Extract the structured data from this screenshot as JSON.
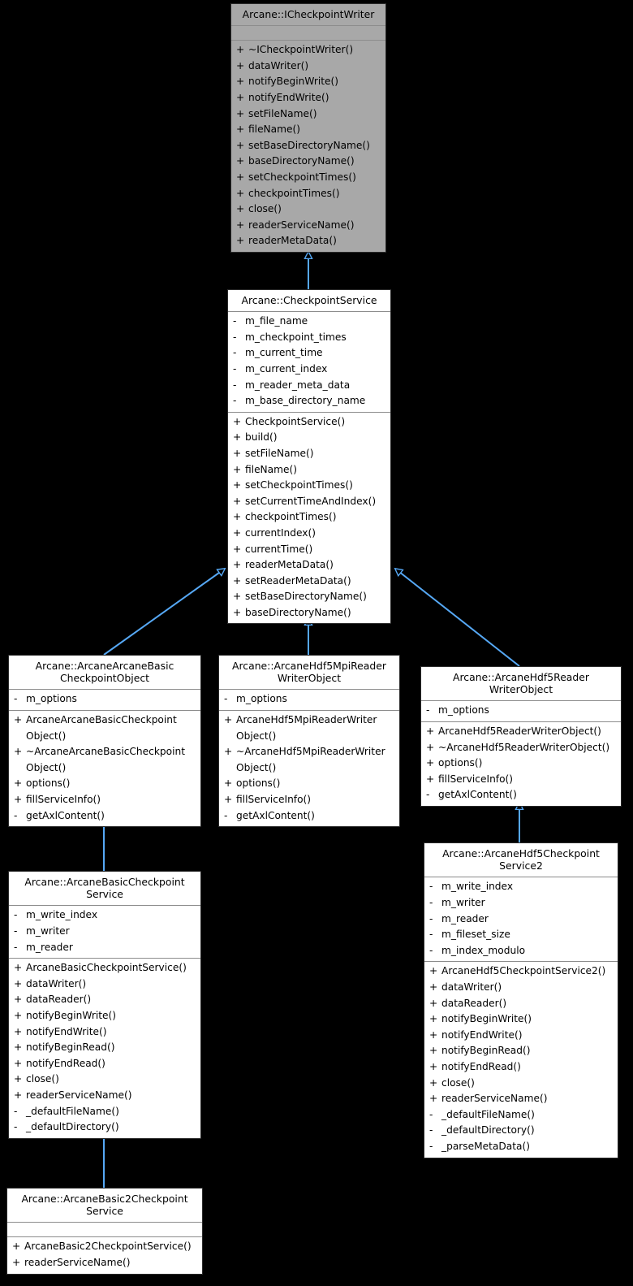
{
  "diagram": {
    "type": "uml-class-inheritance",
    "background": "#000000",
    "edge_color": "#56a8f5",
    "interface_fill": "#a8a8a8",
    "class_fill": "#ffffff"
  },
  "classes": [
    {
      "id": "icheckpointwriter",
      "title": "Arcane::ICheckpointWriter",
      "title_lines": [
        "Arcane::ICheckpointWriter"
      ],
      "attributes": [],
      "methods": [
        {
          "vis": "+",
          "name": "~ICheckpointWriter()"
        },
        {
          "vis": "+",
          "name": "dataWriter()"
        },
        {
          "vis": "+",
          "name": "notifyBeginWrite()"
        },
        {
          "vis": "+",
          "name": "notifyEndWrite()"
        },
        {
          "vis": "+",
          "name": "setFileName()"
        },
        {
          "vis": "+",
          "name": "fileName()"
        },
        {
          "vis": "+",
          "name": "setBaseDirectoryName()"
        },
        {
          "vis": "+",
          "name": "baseDirectoryName()"
        },
        {
          "vis": "+",
          "name": "setCheckpointTimes()"
        },
        {
          "vis": "+",
          "name": "checkpointTimes()"
        },
        {
          "vis": "+",
          "name": "close()"
        },
        {
          "vis": "+",
          "name": "readerServiceName()"
        },
        {
          "vis": "+",
          "name": "readerMetaData()"
        }
      ]
    },
    {
      "id": "checkpointservice",
      "title": "Arcane::CheckpointService",
      "title_lines": [
        "Arcane::CheckpointService"
      ],
      "attributes": [
        {
          "vis": "-",
          "name": "m_file_name"
        },
        {
          "vis": "-",
          "name": "m_checkpoint_times"
        },
        {
          "vis": "-",
          "name": "m_current_time"
        },
        {
          "vis": "-",
          "name": "m_current_index"
        },
        {
          "vis": "-",
          "name": "m_reader_meta_data"
        },
        {
          "vis": "-",
          "name": "m_base_directory_name"
        }
      ],
      "methods": [
        {
          "vis": "+",
          "name": "CheckpointService()"
        },
        {
          "vis": "+",
          "name": "build()"
        },
        {
          "vis": "+",
          "name": "setFileName()"
        },
        {
          "vis": "+",
          "name": "fileName()"
        },
        {
          "vis": "+",
          "name": "setCheckpointTimes()"
        },
        {
          "vis": "+",
          "name": "setCurrentTimeAndIndex()"
        },
        {
          "vis": "+",
          "name": "checkpointTimes()"
        },
        {
          "vis": "+",
          "name": "currentIndex()"
        },
        {
          "vis": "+",
          "name": "currentTime()"
        },
        {
          "vis": "+",
          "name": "readerMetaData()"
        },
        {
          "vis": "+",
          "name": "setReaderMetaData()"
        },
        {
          "vis": "+",
          "name": "setBaseDirectoryName()"
        },
        {
          "vis": "+",
          "name": "baseDirectoryName()"
        }
      ]
    },
    {
      "id": "arcanearcanebasiccheckpointobject",
      "title": "Arcane::ArcaneArcaneBasic CheckpointObject",
      "title_lines": [
        "Arcane::ArcaneArcaneBasic",
        "CheckpointObject"
      ],
      "attributes": [
        {
          "vis": "-",
          "name": "m_options"
        }
      ],
      "methods": [
        {
          "vis": "+",
          "name": "ArcaneArcaneBasicCheckpoint Object()",
          "wrapped": [
            "ArcaneArcaneBasicCheckpoint",
            "Object()"
          ]
        },
        {
          "vis": "+",
          "name": "~ArcaneArcaneBasicCheckpoint Object()",
          "wrapped": [
            "~ArcaneArcaneBasicCheckpoint",
            "Object()"
          ]
        },
        {
          "vis": "+",
          "name": "options()"
        },
        {
          "vis": "+",
          "name": "fillServiceInfo()"
        },
        {
          "vis": "-",
          "name": "getAxlContent()"
        }
      ]
    },
    {
      "id": "arcanehdf5mpireaderwriterobject",
      "title": "Arcane::ArcaneHdf5MpiReader WriterObject",
      "title_lines": [
        "Arcane::ArcaneHdf5MpiReader",
        "WriterObject"
      ],
      "attributes": [
        {
          "vis": "-",
          "name": "m_options"
        }
      ],
      "methods": [
        {
          "vis": "+",
          "name": "ArcaneHdf5MpiReaderWriter Object()",
          "wrapped": [
            "ArcaneHdf5MpiReaderWriter",
            "Object()"
          ]
        },
        {
          "vis": "+",
          "name": "~ArcaneHdf5MpiReaderWriter Object()",
          "wrapped": [
            "~ArcaneHdf5MpiReaderWriter",
            "Object()"
          ]
        },
        {
          "vis": "+",
          "name": "options()"
        },
        {
          "vis": "+",
          "name": "fillServiceInfo()"
        },
        {
          "vis": "-",
          "name": "getAxlContent()"
        }
      ]
    },
    {
      "id": "arcanehdf5readerwriterobject",
      "title": "Arcane::ArcaneHdf5Reader WriterObject",
      "title_lines": [
        "Arcane::ArcaneHdf5Reader",
        "WriterObject"
      ],
      "attributes": [
        {
          "vis": "-",
          "name": "m_options"
        }
      ],
      "methods": [
        {
          "vis": "+",
          "name": "ArcaneHdf5ReaderWriterObject()"
        },
        {
          "vis": "+",
          "name": "~ArcaneHdf5ReaderWriterObject()"
        },
        {
          "vis": "+",
          "name": "options()"
        },
        {
          "vis": "+",
          "name": "fillServiceInfo()"
        },
        {
          "vis": "-",
          "name": "getAxlContent()"
        }
      ]
    },
    {
      "id": "arcanebasiccheckpointservice",
      "title": "Arcane::ArcaneBasicCheckpoint Service",
      "title_lines": [
        "Arcane::ArcaneBasicCheckpoint",
        "Service"
      ],
      "attributes": [
        {
          "vis": "-",
          "name": "m_write_index"
        },
        {
          "vis": "-",
          "name": "m_writer"
        },
        {
          "vis": "-",
          "name": "m_reader"
        }
      ],
      "methods": [
        {
          "vis": "+",
          "name": "ArcaneBasicCheckpointService()"
        },
        {
          "vis": "+",
          "name": "dataWriter()"
        },
        {
          "vis": "+",
          "name": "dataReader()"
        },
        {
          "vis": "+",
          "name": "notifyBeginWrite()"
        },
        {
          "vis": "+",
          "name": "notifyEndWrite()"
        },
        {
          "vis": "+",
          "name": "notifyBeginRead()"
        },
        {
          "vis": "+",
          "name": "notifyEndRead()"
        },
        {
          "vis": "+",
          "name": "close()"
        },
        {
          "vis": "+",
          "name": "readerServiceName()"
        },
        {
          "vis": "-",
          "name": "_defaultFileName()"
        },
        {
          "vis": "-",
          "name": "_defaultDirectory()"
        }
      ]
    },
    {
      "id": "arcanehdf5checkpointservice2",
      "title": "Arcane::ArcaneHdf5Checkpoint Service2",
      "title_lines": [
        "Arcane::ArcaneHdf5Checkpoint",
        "Service2"
      ],
      "attributes": [
        {
          "vis": "-",
          "name": "m_write_index"
        },
        {
          "vis": "-",
          "name": "m_writer"
        },
        {
          "vis": "-",
          "name": "m_reader"
        },
        {
          "vis": "-",
          "name": "m_fileset_size"
        },
        {
          "vis": "-",
          "name": "m_index_modulo"
        }
      ],
      "methods": [
        {
          "vis": "+",
          "name": "ArcaneHdf5CheckpointService2()"
        },
        {
          "vis": "+",
          "name": "dataWriter()"
        },
        {
          "vis": "+",
          "name": "dataReader()"
        },
        {
          "vis": "+",
          "name": "notifyBeginWrite()"
        },
        {
          "vis": "+",
          "name": "notifyEndWrite()"
        },
        {
          "vis": "+",
          "name": "notifyBeginRead()"
        },
        {
          "vis": "+",
          "name": "notifyEndRead()"
        },
        {
          "vis": "+",
          "name": "close()"
        },
        {
          "vis": "+",
          "name": "readerServiceName()"
        },
        {
          "vis": "-",
          "name": "_defaultFileName()"
        },
        {
          "vis": "-",
          "name": "_defaultDirectory()"
        },
        {
          "vis": "-",
          "name": "_parseMetaData()"
        }
      ]
    },
    {
      "id": "arcanebasic2checkpointservice",
      "title": "Arcane::ArcaneBasic2Checkpoint Service",
      "title_lines": [
        "Arcane::ArcaneBasic2Checkpoint",
        "Service"
      ],
      "attributes": [],
      "methods": [
        {
          "vis": "+",
          "name": "ArcaneBasic2CheckpointService()"
        },
        {
          "vis": "+",
          "name": "readerServiceName()"
        }
      ]
    }
  ],
  "edges": [
    {
      "from": "checkpointservice",
      "to": "icheckpointwriter",
      "kind": "inheritance"
    },
    {
      "from": "arcanearcanebasiccheckpointobject",
      "to": "checkpointservice",
      "kind": "inheritance"
    },
    {
      "from": "arcanehdf5mpireaderwriterobject",
      "to": "checkpointservice",
      "kind": "inheritance"
    },
    {
      "from": "arcanehdf5readerwriterobject",
      "to": "checkpointservice",
      "kind": "inheritance"
    },
    {
      "from": "arcanebasiccheckpointservice",
      "to": "arcanearcanebasiccheckpointobject",
      "kind": "inheritance"
    },
    {
      "from": "arcanehdf5checkpointservice2",
      "to": "arcanehdf5readerwriterobject",
      "kind": "inheritance"
    },
    {
      "from": "arcanebasic2checkpointservice",
      "to": "arcanebasiccheckpointservice",
      "kind": "inheritance"
    }
  ]
}
